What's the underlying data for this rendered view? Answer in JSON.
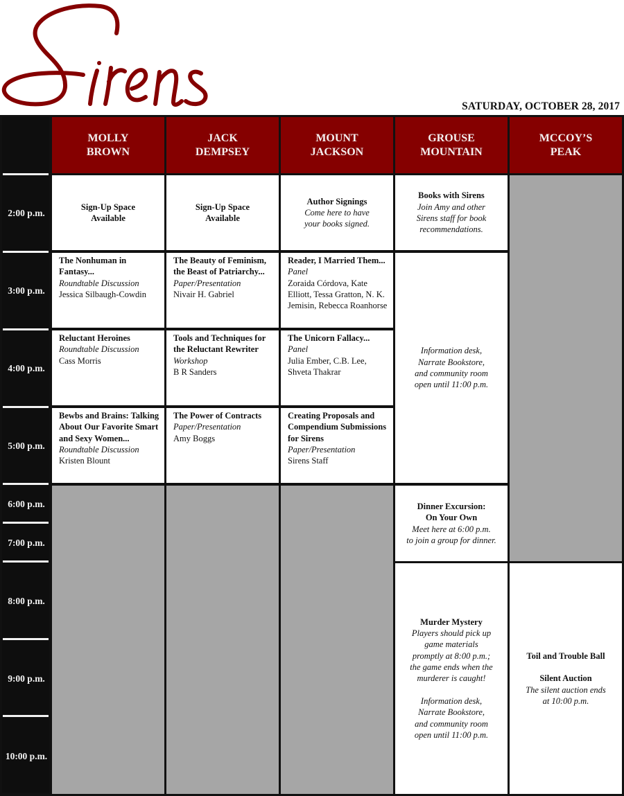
{
  "brand": {
    "logo_text": "Sirens",
    "brand_color": "#850000"
  },
  "date": "SATURDAY, OCTOBER 28, 2017",
  "colors": {
    "header_bg": "#850000",
    "time_column_bg": "#0e0e0e",
    "empty_slot_bg": "#a6a6a6",
    "session_bg": "#ffffff"
  },
  "rooms": [
    {
      "line1": "MOLLY",
      "line2": "BROWN"
    },
    {
      "line1": "JACK",
      "line2": "DEMPSEY"
    },
    {
      "line1": "MOUNT",
      "line2": "JACKSON"
    },
    {
      "line1": "GROUSE",
      "line2": "MOUNTAIN"
    },
    {
      "line1": "MCCOY’S",
      "line2": "PEAK"
    }
  ],
  "times": [
    "2:00 p.m.",
    "3:00 p.m.",
    "4:00 p.m.",
    "5:00 p.m.",
    "6:00 p.m.",
    "7:00 p.m.",
    "8:00 p.m.",
    "9:00 p.m.",
    "10:00 p.m."
  ],
  "slots": {
    "molly_2pm": {
      "line1": "Sign-Up Space",
      "line2": "Available"
    },
    "jack_2pm": {
      "line1": "Sign-Up Space",
      "line2": "Available"
    },
    "mount_2pm": {
      "title": "Author Signings",
      "desc1": "Come here to have",
      "desc2": "your books signed."
    },
    "grouse_2pm": {
      "title": "Books with Sirens",
      "desc1": "Join Amy and other",
      "desc2": "Sirens staff for book",
      "desc3": "recommendations."
    },
    "molly_3pm": {
      "title1": "The Nonhuman in",
      "title2": "Fantasy...",
      "type": "Roundtable Discussion",
      "people1": "Jessica Silbaugh-Cowdin"
    },
    "jack_3pm": {
      "title1": "The Beauty of Feminism,",
      "title2": "the Beast of Patriarchy...",
      "type": "Paper/Presentation",
      "people1": "Nivair H. Gabriel"
    },
    "mount_3pm": {
      "title1": "Reader, I Married Them...",
      "type": "Panel",
      "people1": "Zoraida Córdova, Kate",
      "people2": "Elliott, Tessa Gratton, N. K.",
      "people3": "Jemisin, Rebecca Roanhorse"
    },
    "grouse_3to6pm": {
      "desc1": "Information desk,",
      "desc2": "Narrate Bookstore,",
      "desc3": "and community room",
      "desc4": "open until 11:00 p.m."
    },
    "molly_4pm": {
      "title1": "Reluctant Heroines",
      "type": "Roundtable Discussion",
      "people1": "Cass Morris"
    },
    "jack_4pm": {
      "title1": "Tools and Techniques for",
      "title2": "the Reluctant Rewriter",
      "type": "Workshop",
      "people1": "B R Sanders"
    },
    "mount_4pm": {
      "title1": "The Unicorn Fallacy...",
      "type": "Panel",
      "people1": "Julia Ember, C.B. Lee,",
      "people2": "Shveta Thakrar"
    },
    "molly_5pm": {
      "title1": "Bewbs and Brains: Talking",
      "title2": "About Our Favorite Smart",
      "title3": "and Sexy Women...",
      "type": "Roundtable Discussion",
      "people1": "Kristen Blount"
    },
    "jack_5pm": {
      "title1": "The Power of Contracts",
      "type": "Paper/Presentation",
      "people1": "Amy Boggs"
    },
    "mount_5pm": {
      "title1": "Creating Proposals and",
      "title2": "Compendium Submissions",
      "title3": "for Sirens",
      "type": "Paper/Presentation",
      "people1": "Sirens Staff"
    },
    "grouse_6pm": {
      "title1": "Dinner Excursion:",
      "title2": "On Your Own",
      "desc1": "Meet here at 6:00 p.m.",
      "desc2": "to join a group for dinner."
    },
    "grouse_8pm": {
      "title": "Murder Mystery",
      "desc1": "Players should pick up",
      "desc2": "game materials",
      "desc3": "promptly at 8:00 p.m.;",
      "desc4": "the game ends when the",
      "desc5": "murderer is caught!",
      "info1": "Information desk,",
      "info2": "Narrate Bookstore,",
      "info3": "and community room",
      "info4": "open until 11:00 p.m."
    },
    "mccoy_8pm": {
      "title1": "Toil and Trouble Ball",
      "title2": "Silent Auction",
      "desc1": "The silent auction ends",
      "desc2": "at 10:00 p.m."
    }
  }
}
